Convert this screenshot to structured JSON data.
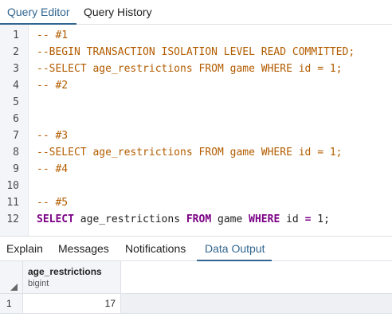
{
  "top_tabs": [
    {
      "label": "Query Editor",
      "active": true
    },
    {
      "label": "Query History",
      "active": false
    }
  ],
  "editor": {
    "lines": [
      {
        "n": "1",
        "tokens": [
          {
            "t": "-- #1",
            "c": "cm"
          }
        ]
      },
      {
        "n": "2",
        "tokens": [
          {
            "t": "--BEGIN TRANSACTION ISOLATION LEVEL READ COMMITTED;",
            "c": "cm"
          }
        ]
      },
      {
        "n": "3",
        "tokens": [
          {
            "t": "--SELECT age_restrictions FROM game WHERE id = 1;",
            "c": "cm"
          }
        ]
      },
      {
        "n": "4",
        "tokens": [
          {
            "t": "-- #2",
            "c": "cm"
          }
        ]
      },
      {
        "n": "5",
        "tokens": []
      },
      {
        "n": "6",
        "tokens": []
      },
      {
        "n": "7",
        "tokens": [
          {
            "t": "-- #3",
            "c": "cm"
          }
        ]
      },
      {
        "n": "8",
        "tokens": [
          {
            "t": "--SELECT age_restrictions FROM game WHERE id = 1;",
            "c": "cm"
          }
        ]
      },
      {
        "n": "9",
        "tokens": [
          {
            "t": "-- #4",
            "c": "cm"
          }
        ]
      },
      {
        "n": "10",
        "tokens": []
      },
      {
        "n": "11",
        "tokens": [
          {
            "t": "-- #5",
            "c": "cm"
          }
        ]
      },
      {
        "n": "12",
        "tokens": [
          {
            "t": "SELECT",
            "c": "kw"
          },
          {
            "t": " age_restrictions ",
            "c": "pl"
          },
          {
            "t": "FROM",
            "c": "kw"
          },
          {
            "t": " game ",
            "c": "pl"
          },
          {
            "t": "WHERE",
            "c": "kw"
          },
          {
            "t": " id ",
            "c": "pl"
          },
          {
            "t": "=",
            "c": "kw"
          },
          {
            "t": " 1;",
            "c": "num"
          }
        ]
      }
    ]
  },
  "bottom_tabs": [
    {
      "label": "Explain",
      "active": false
    },
    {
      "label": "Messages",
      "active": false
    },
    {
      "label": "Notifications",
      "active": false
    },
    {
      "label": "Data Output",
      "active": true
    }
  ],
  "grid": {
    "column": {
      "name": "age_restrictions",
      "type": "bigint"
    },
    "rows": [
      {
        "row_num": "1",
        "value": "17"
      }
    ]
  },
  "colors": {
    "accent": "#326690",
    "comment": "#b35c00",
    "keyword": "#7b0085",
    "gutter_bg": "#f3f5f9"
  }
}
